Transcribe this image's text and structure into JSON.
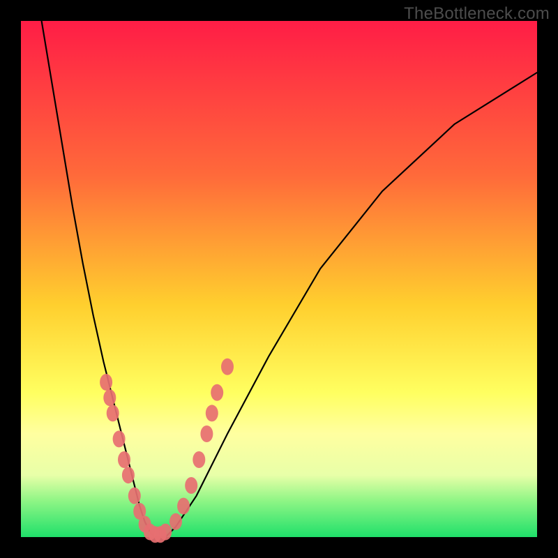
{
  "watermark": "TheBottleneck.com",
  "chart_data": {
    "type": "line",
    "title": "",
    "xlabel": "",
    "ylabel": "",
    "xlim": [
      0,
      100
    ],
    "ylim": [
      0,
      100
    ],
    "grid": false,
    "legend": false,
    "series": [
      {
        "name": "bottleneck-curve",
        "x": [
          4,
          6,
          8,
          10,
          12,
          14,
          16,
          18,
          20,
          22,
          23,
          24,
          25,
          26,
          28,
          30,
          34,
          40,
          48,
          58,
          70,
          84,
          100
        ],
        "values": [
          100,
          88,
          76,
          64,
          53,
          43,
          34,
          26,
          18,
          10,
          6,
          3,
          1,
          0,
          0,
          2,
          8,
          20,
          35,
          52,
          67,
          80,
          90
        ]
      }
    ],
    "scatter": {
      "name": "highlight-points",
      "color": "#e76f71",
      "points": [
        {
          "x": 16.5,
          "y": 30
        },
        {
          "x": 17.2,
          "y": 27
        },
        {
          "x": 17.8,
          "y": 24
        },
        {
          "x": 19.0,
          "y": 19
        },
        {
          "x": 20.0,
          "y": 15
        },
        {
          "x": 20.8,
          "y": 12
        },
        {
          "x": 22.0,
          "y": 8
        },
        {
          "x": 23.0,
          "y": 5
        },
        {
          "x": 24.0,
          "y": 2.5
        },
        {
          "x": 25.0,
          "y": 1
        },
        {
          "x": 26.0,
          "y": 0.5
        },
        {
          "x": 27.0,
          "y": 0.5
        },
        {
          "x": 28.0,
          "y": 1
        },
        {
          "x": 30.0,
          "y": 3
        },
        {
          "x": 31.5,
          "y": 6
        },
        {
          "x": 33.0,
          "y": 10
        },
        {
          "x": 34.5,
          "y": 15
        },
        {
          "x": 36.0,
          "y": 20
        },
        {
          "x": 37.0,
          "y": 24
        },
        {
          "x": 38.0,
          "y": 28
        },
        {
          "x": 40.0,
          "y": 33
        }
      ]
    }
  }
}
